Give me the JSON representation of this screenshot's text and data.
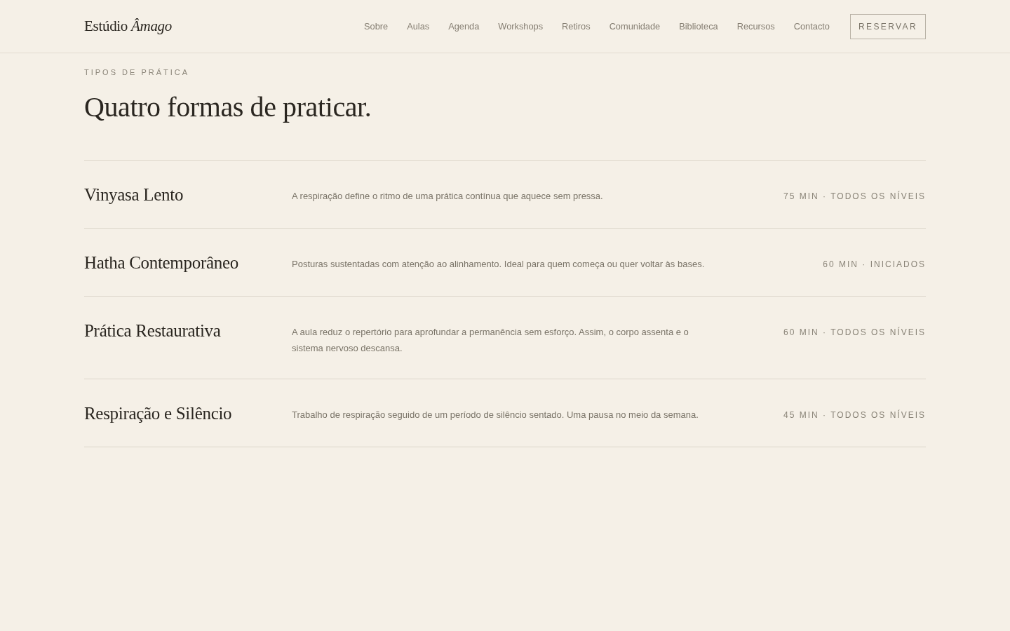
{
  "header": {
    "brand": "Estúdio *Âmago*",
    "nav": [
      "Sobre",
      "Aulas",
      "Agenda",
      "Workshops",
      "Retiros",
      "Comunidade",
      "Biblioteca",
      "Recursos",
      "Contacto"
    ],
    "cta": "RESERVAR"
  },
  "section": {
    "eyebrow": "TIPOS DE PRÁTICA",
    "title": "Quatro formas de praticar.",
    "practices": [
      {
        "name": "Vinyasa Lento",
        "description": "A respiração define o ritmo de uma prática contínua que aquece sem pressa.",
        "meta": "75 MIN · TODOS OS NÍVEIS"
      },
      {
        "name": "Hatha Contemporâneo",
        "description": "Posturas sustentadas com atenção ao alinhamento. Ideal para quem começa ou quer voltar às bases.",
        "meta": "60 MIN · INICIADOS"
      },
      {
        "name": "Prática Restaurativa",
        "description": "A aula reduz o repertório para aprofundar a permanência sem esforço. Assim, o corpo assenta e o sistema nervoso descansa.",
        "meta": "60 MIN · TODOS OS NÍVEIS"
      },
      {
        "name": "Respiração e Silêncio",
        "description": "Trabalho de respiração seguido de um período de silêncio sentado. Uma pausa no meio da semana.",
        "meta": "45 MIN · TODOS OS NÍVEIS"
      }
    ]
  }
}
